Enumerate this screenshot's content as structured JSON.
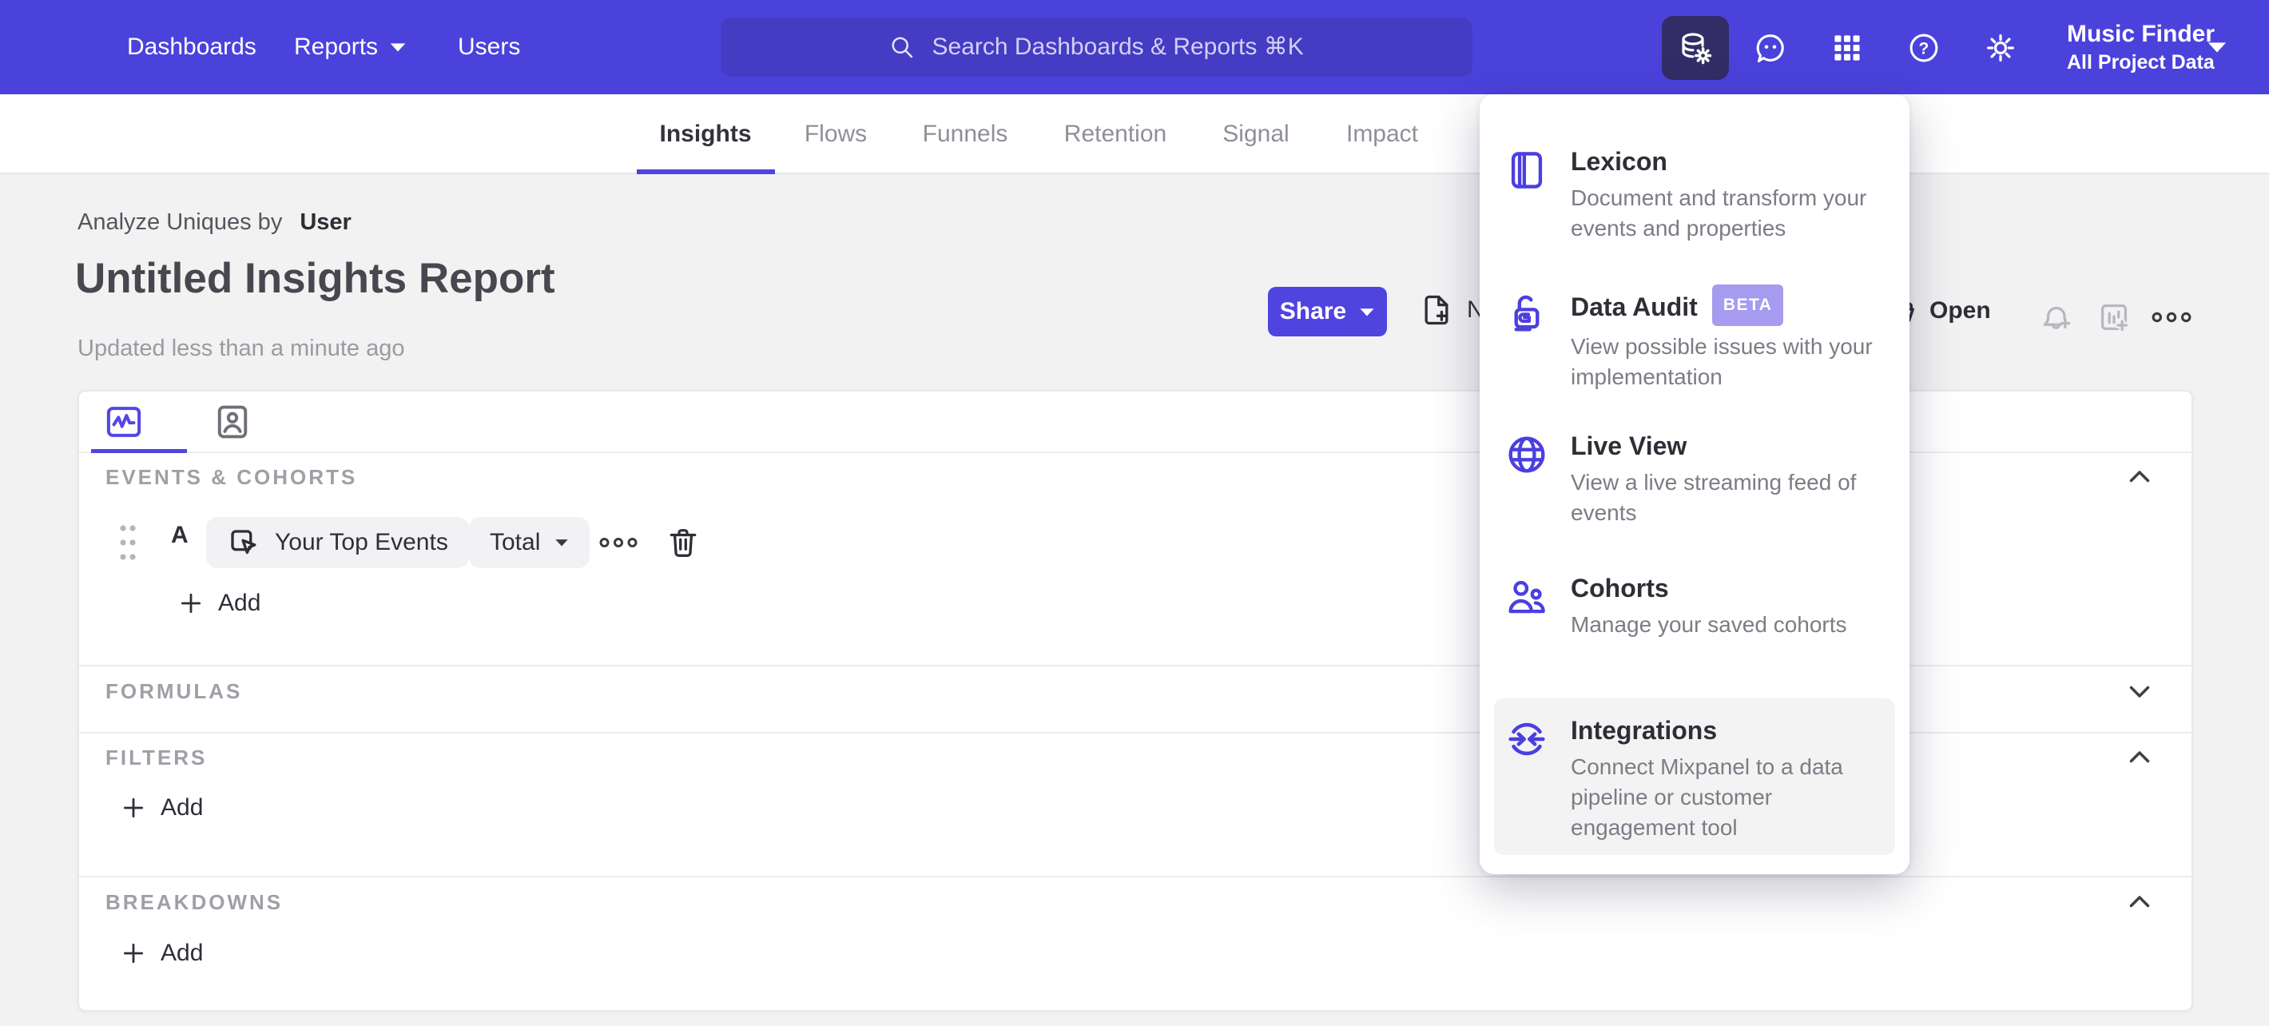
{
  "colors": {
    "accent": "#4f44e0",
    "nav_background": "#4b42dc",
    "search_background": "#453cc4",
    "active_tool_background": "#322d66",
    "beta_badge": "#a69bee",
    "page_background": "#f2f2f3"
  },
  "nav": {
    "items": [
      {
        "label": "Dashboards"
      },
      {
        "label": "Reports",
        "has_caret": true
      },
      {
        "label": "Users"
      }
    ],
    "search_placeholder": "Search Dashboards & Reports ⌘K",
    "tools": [
      "data-management",
      "feedback",
      "apps",
      "help",
      "settings"
    ],
    "project": {
      "name": "Music Finder",
      "scope": "All Project Data"
    }
  },
  "tabs": {
    "active": "Insights",
    "items": [
      {
        "label": "Insights"
      },
      {
        "label": "Flows"
      },
      {
        "label": "Funnels"
      },
      {
        "label": "Retention"
      },
      {
        "label": "Signal"
      },
      {
        "label": "Impact"
      }
    ]
  },
  "report": {
    "analyze_prefix": "Analyze Uniques by",
    "analyze_value": "User",
    "title": "Untitled Insights Report",
    "updated": "Updated less than a minute ago",
    "share_label": "Share",
    "new_label": "New",
    "open_label": "Open"
  },
  "builder": {
    "add_label": "Add",
    "sections": [
      {
        "label": "EVENTS & COHORTS",
        "collapsed": false
      },
      {
        "label": "FORMULAS",
        "collapsed": true
      },
      {
        "label": "FILTERS",
        "collapsed": false
      },
      {
        "label": "BREAKDOWNS",
        "collapsed": false
      }
    ],
    "event_row": {
      "letter": "A",
      "event_label": "Your Top Events",
      "metric_label": "Total"
    }
  },
  "menu": {
    "items": [
      {
        "icon": "lexicon-book-icon",
        "title": "Lexicon",
        "description": "Document and transform your events and properties"
      },
      {
        "icon": "data-audit-lock-icon",
        "title": "Data Audit",
        "badge": "BETA",
        "description": "View possible issues with your implementation"
      },
      {
        "icon": "live-view-globe-icon",
        "title": "Live View",
        "description": "View a live streaming feed of events"
      },
      {
        "icon": "cohorts-people-icon",
        "title": "Cohorts",
        "description": "Manage your saved cohorts"
      },
      {
        "icon": "integrations-sync-icon",
        "title": "Integrations",
        "highlighted": true,
        "description": "Connect Mixpanel to a data pipeline or customer engagement tool"
      }
    ]
  }
}
